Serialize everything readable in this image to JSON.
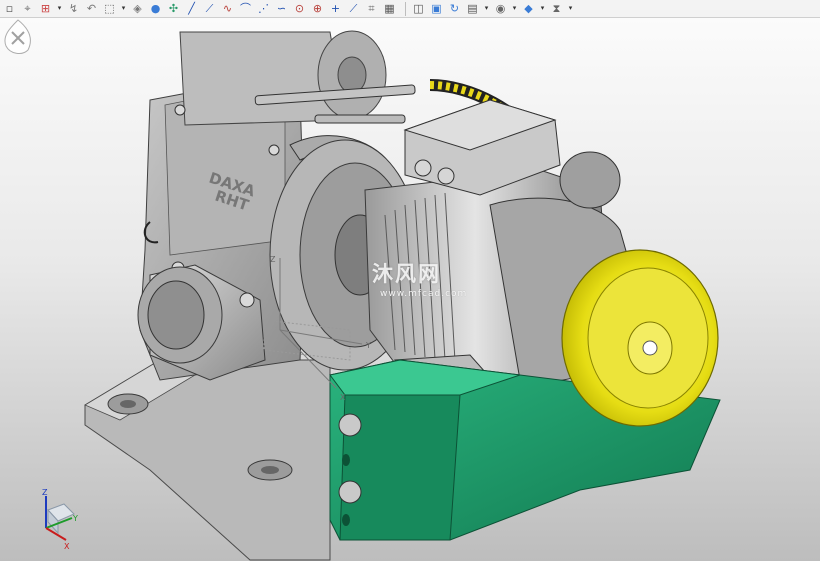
{
  "toolbar": {
    "groups": [
      {
        "icons": [
          "select-filter-icon",
          "snap-icon",
          "create-datum-icon",
          "dropdown-icon",
          "curve-tool-icon",
          "arc-tool-icon",
          "rectangle-tool-icon",
          "dropdown-icon",
          "solid-display-icon",
          "shaded-display-icon",
          "point-tool-icon",
          "line-tool-icon",
          "polyline-tool-icon",
          "spline-tool-icon",
          "fillet-tool-icon",
          "sketch-curve-icon",
          "curve-offset-icon",
          "circle-tool-icon",
          "circle-center-icon",
          "plus-point-icon",
          "line-draw-icon",
          "measure-icon",
          "grid-icon"
        ]
      },
      {
        "icons": [
          "view-orient-icon",
          "view-named-icon",
          "rotate-view-icon",
          "render-style-icon",
          "dropdown-icon",
          "camera-icon",
          "dropdown-icon",
          "cube-view-icon",
          "dropdown-icon",
          "filter-view-icon",
          "dropdown-icon"
        ]
      }
    ]
  },
  "viewport": {
    "model_labels": {
      "brand_line1": "DAXA",
      "brand_line2": "RHT"
    },
    "watermark": {
      "text": "沐风网",
      "url": "www.mfcad.com"
    },
    "csys_labels": {
      "z": "Z",
      "y": "Y",
      "x": "X"
    },
    "triad_labels": {
      "z": "Z",
      "y": "Y",
      "x": "X"
    },
    "colors": {
      "base_green": "#1e9f6c",
      "handwheel_yellow": "#e8e01a",
      "body_gray": "#a8a8a8"
    }
  }
}
